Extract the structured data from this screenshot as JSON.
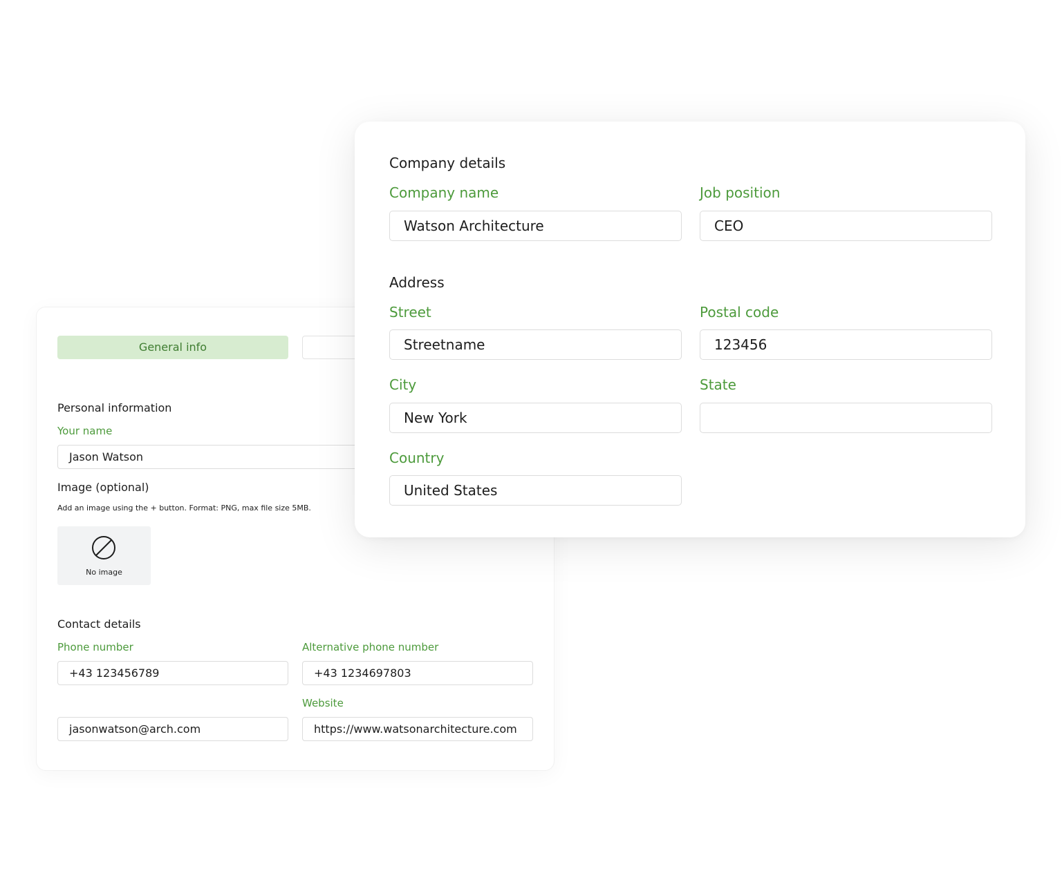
{
  "general": {
    "tabs": [
      {
        "label": "General info",
        "active": true
      },
      {
        "label": "",
        "active": false
      }
    ],
    "personal": {
      "heading": "Personal information",
      "name_label": "Your name",
      "name_value": "Jason Watson",
      "image_heading": "Image (optional)",
      "image_hint": "Add an image using the + button. Format: PNG, max file size 5MB.",
      "no_image_label": "No image",
      "no_image_icon": "no-image-icon"
    },
    "contact": {
      "heading": "Contact details",
      "phone_label": "Phone number",
      "phone_value": "+43 123456789",
      "alt_phone_label": "Alternative phone number",
      "alt_phone_value": "+43 1234697803",
      "email_value": "jasonwatson@arch.com",
      "website_label": "Website",
      "website_value": "https://www.watsonarchitecture.com"
    }
  },
  "company": {
    "heading": "Company details",
    "name_label": "Company name",
    "name_value": "Watson Architecture",
    "job_label": "Job position",
    "job_value": "CEO"
  },
  "address": {
    "heading": "Address",
    "street_label": "Street",
    "street_value": "Streetname",
    "postal_label": "Postal code",
    "postal_value": "123456",
    "city_label": "City",
    "city_value": "New York",
    "state_label": "State",
    "state_value": "",
    "country_label": "Country",
    "country_value": "United States"
  },
  "colors": {
    "accent_green": "#4c9a3b",
    "tab_active_bg": "#d7ecd0",
    "border": "#dcdcdc"
  }
}
